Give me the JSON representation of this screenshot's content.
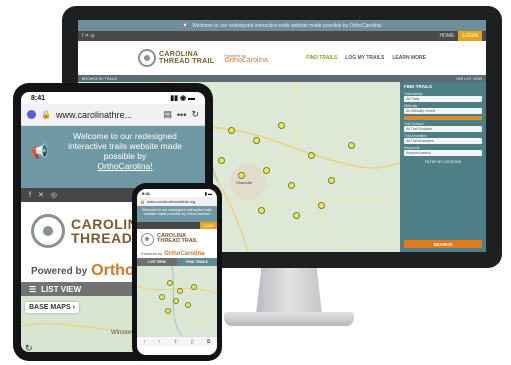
{
  "desktop": {
    "banner_text": "Welcome to our redesigned interactive trails website made possible by OrthoCarolina!",
    "topbar": {
      "home_label": "HOME",
      "login_label": "LOGIN"
    },
    "logo": {
      "line1": "CAROLINA",
      "line2": "THREAD TRAIL"
    },
    "powered": {
      "prefix": "Powered by",
      "brand": "OrthoCarolina"
    },
    "nav": [
      "FIND TRAILS",
      "LOG MY TRAILS",
      "LEARN MORE"
    ],
    "subbar": {
      "left": "BROWSE BY TRAILS",
      "right": "SEE LIST VIEW"
    },
    "panel": {
      "title": "FIND TRAILS",
      "fields": [
        {
          "label": "Trail Activity",
          "value": "All Trails"
        },
        {
          "label": "Difficulty",
          "value": "All Difficulty Levels"
        },
        {
          "label": "Trail Surface",
          "value": "All Trail Surfaces"
        },
        {
          "label": "Trail Amenities",
          "value": "All Trail Amenities"
        },
        {
          "label": "Keywords",
          "value": "Keyword search"
        }
      ],
      "location_label": "FILTER BY LOCATION",
      "search_label": "SEARCH"
    },
    "map_city": "Charlotte"
  },
  "tablet": {
    "time": "8:41",
    "url": "www.carolinathre...",
    "banner": {
      "line": "Welcome to our redesigned interactive trails website made possible by",
      "link": "OrthoCarolina!"
    },
    "logo": {
      "line1": "CAROLINA",
      "line2": "THREAD TRAIL"
    },
    "powered": {
      "prefix": "Powered by",
      "brand": "Ortho"
    },
    "list_view_label": "LIST VIEW",
    "base_maps_label": "BASE MAPS",
    "map_label": "Winston-Sal"
  },
  "phone": {
    "time": "9:41",
    "url": "www.carolinathreadtrail.org",
    "banner_text": "Welcome to our redesigned interactive trails website made possible by OrthoCarolina!",
    "login_label": "LOGIN",
    "logo": {
      "line1": "CAROLINA",
      "line2": "THREAD TRAIL"
    },
    "powered": {
      "prefix": "Powered by",
      "brand": "OrthoCarolina"
    },
    "tabs": [
      "LIST VIEW",
      "FIND TRAILS"
    ]
  },
  "colors": {
    "teal": "#6e98a3",
    "panel_teal": "#4f7f86",
    "orange": "#e07a1f",
    "gold": "#e3a51e",
    "logo_brown": "#7a5b2f",
    "marker_yellow": "#e7ea5c"
  }
}
